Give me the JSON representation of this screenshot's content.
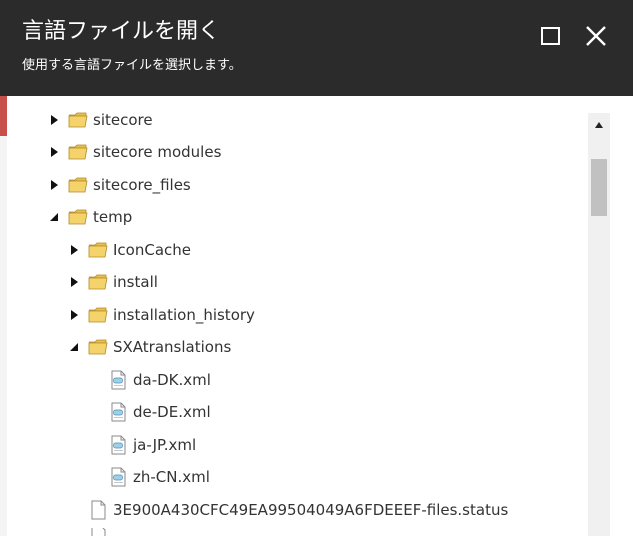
{
  "dialog": {
    "title": "言語ファイルを開く",
    "subtitle": "使用する言語ファイルを選択します。",
    "maximize_icon": "maximize-icon",
    "close_icon": "close-icon"
  },
  "tree": {
    "items": [
      {
        "label": "sitecore",
        "type": "folder",
        "state": "collapsed"
      },
      {
        "label": "sitecore modules",
        "type": "folder",
        "state": "collapsed"
      },
      {
        "label": "sitecore_files",
        "type": "folder",
        "state": "collapsed"
      },
      {
        "label": "temp",
        "type": "folder",
        "state": "expanded"
      },
      {
        "label": "IconCache",
        "type": "folder",
        "state": "collapsed"
      },
      {
        "label": "install",
        "type": "folder",
        "state": "collapsed"
      },
      {
        "label": "installation_history",
        "type": "folder",
        "state": "collapsed"
      },
      {
        "label": "SXAtranslations",
        "type": "folder",
        "state": "expanded"
      },
      {
        "label": "da-DK.xml",
        "type": "xml-file"
      },
      {
        "label": "de-DE.xml",
        "type": "xml-file"
      },
      {
        "label": "ja-JP.xml",
        "type": "xml-file"
      },
      {
        "label": "zh-CN.xml",
        "type": "xml-file"
      },
      {
        "label": "3E900A430CFC49EA99504049A6FDEEEF-files.status",
        "type": "file"
      }
    ]
  },
  "colors": {
    "header_bg": "#2b2b2b",
    "folder_fill": "#f5d36b",
    "accent_stripe": "#c8504b"
  }
}
